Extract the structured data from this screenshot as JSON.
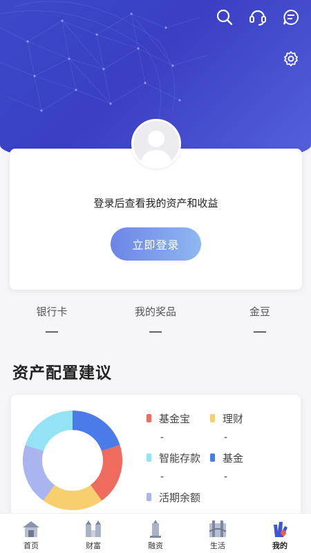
{
  "header": {
    "icons": [
      "search-icon",
      "customer-service-icon",
      "message-icon",
      "gear-icon"
    ]
  },
  "login": {
    "hint": "登录后查看我的资产和收益",
    "button_label": "立即登录"
  },
  "stats": [
    {
      "label": "银行卡",
      "value": "—"
    },
    {
      "label": "我的奖品",
      "value": "—"
    },
    {
      "label": "金豆",
      "value": "—"
    }
  ],
  "allocation": {
    "title": "资产配置建议",
    "legend": [
      {
        "name": "基金宝",
        "value": "-",
        "color": "#ef6b5e"
      },
      {
        "name": "理财",
        "value": "-",
        "color": "#f7cf6e"
      },
      {
        "name": "智能存款",
        "value": "-",
        "color": "#93e3f4"
      },
      {
        "name": "基金",
        "value": "-",
        "color": "#4a7be8"
      },
      {
        "name": "活期余额",
        "value": "",
        "color": "#aab4ee"
      }
    ],
    "donut_colors": [
      "#4a7be8",
      "#ef6b5e",
      "#f7cf6e",
      "#aab4ee",
      "#93e3f4"
    ]
  },
  "tabbar": {
    "items": [
      {
        "label": "首页",
        "icon": "home-icon",
        "active": false
      },
      {
        "label": "财富",
        "icon": "wealth-icon",
        "active": false
      },
      {
        "label": "融资",
        "icon": "finance-icon",
        "active": false
      },
      {
        "label": "生活",
        "icon": "life-icon",
        "active": false
      },
      {
        "label": "我的",
        "icon": "mine-icon",
        "active": true
      }
    ]
  }
}
